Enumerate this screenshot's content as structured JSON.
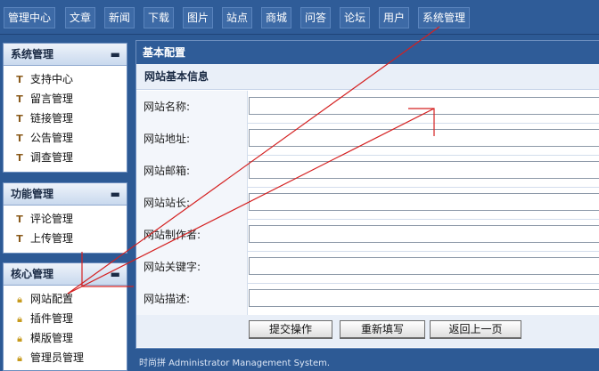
{
  "topnav": [
    "管理中心",
    "文章",
    "新闻",
    "下载",
    "图片",
    "站点",
    "商城",
    "问答",
    "论坛",
    "用户",
    "系统管理"
  ],
  "sidebar": {
    "system": {
      "title": "系统管理",
      "collapse": "▬",
      "items": [
        "支持中心",
        "留言管理",
        "链接管理",
        "公告管理",
        "调查管理"
      ]
    },
    "function": {
      "title": "功能管理",
      "collapse": "▬",
      "items": [
        "评论管理",
        "上传管理"
      ]
    },
    "core": {
      "title": "核心管理",
      "collapse": "▬",
      "items": [
        "网站配置",
        "插件管理",
        "模版管理",
        "管理员管理"
      ]
    }
  },
  "icons": {
    "wrench": "wrench-icon",
    "lock": "lock-icon"
  },
  "main": {
    "title": "基本配置",
    "subtitle": "网站基本信息",
    "fields": [
      {
        "label": "网站名称:",
        "value": ""
      },
      {
        "label": "网站地址:",
        "value": ""
      },
      {
        "label": "网站邮箱:",
        "value": ""
      },
      {
        "label": "网站站长:",
        "value": ""
      },
      {
        "label": "网站制作者:",
        "value": ""
      },
      {
        "label": "网站关键字:",
        "value": ""
      },
      {
        "label": "网站描述:",
        "value": ""
      }
    ],
    "buttons": {
      "submit": "提交操作",
      "reset": "重新填写",
      "back": "返回上一页"
    }
  },
  "footer": "时尚拼 Administrator Management System.",
  "colors": {
    "nav_bg": "#2f5c98",
    "page_bg": "#2d5a95",
    "annotation": "#d42020"
  }
}
